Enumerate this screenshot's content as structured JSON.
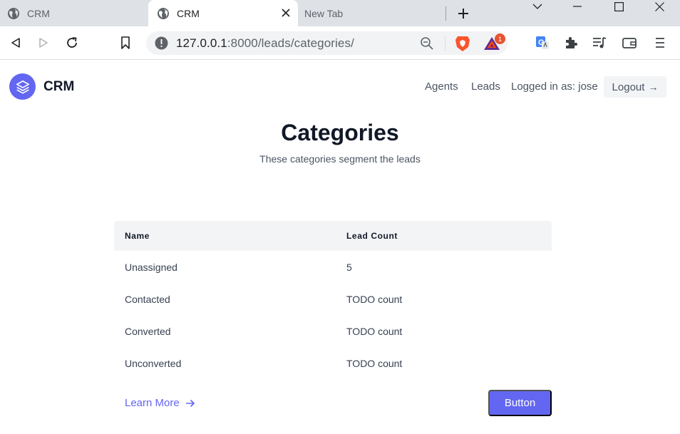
{
  "browser": {
    "tabs": [
      {
        "title": "CRM",
        "active": false
      },
      {
        "title": "CRM",
        "active": true
      },
      {
        "title": "New Tab",
        "active": false
      }
    ],
    "url_host": "127.0.0.1",
    "url_path": ":8000/leads/categories/",
    "rewards_badge": "1"
  },
  "navbar": {
    "brand": "CRM",
    "links": {
      "agents": "Agents",
      "leads": "Leads"
    },
    "logged_in": "Logged in as: jose",
    "logout": "Logout",
    "logout_arrow": "→"
  },
  "header": {
    "title": "Categories",
    "subtitle": "These categories segment the leads"
  },
  "table": {
    "columns": [
      "Name",
      "Lead Count"
    ],
    "rows": [
      {
        "name": "Unassigned",
        "count": "5"
      },
      {
        "name": "Contacted",
        "count": "TODO count"
      },
      {
        "name": "Converted",
        "count": "TODO count"
      },
      {
        "name": "Unconverted",
        "count": "TODO count"
      }
    ]
  },
  "footer": {
    "learn_more": "Learn More",
    "button": "Button"
  },
  "colors": {
    "accent": "#6366f1",
    "tabstrip": "#dee1e6",
    "table_header_bg": "#f3f4f6"
  }
}
